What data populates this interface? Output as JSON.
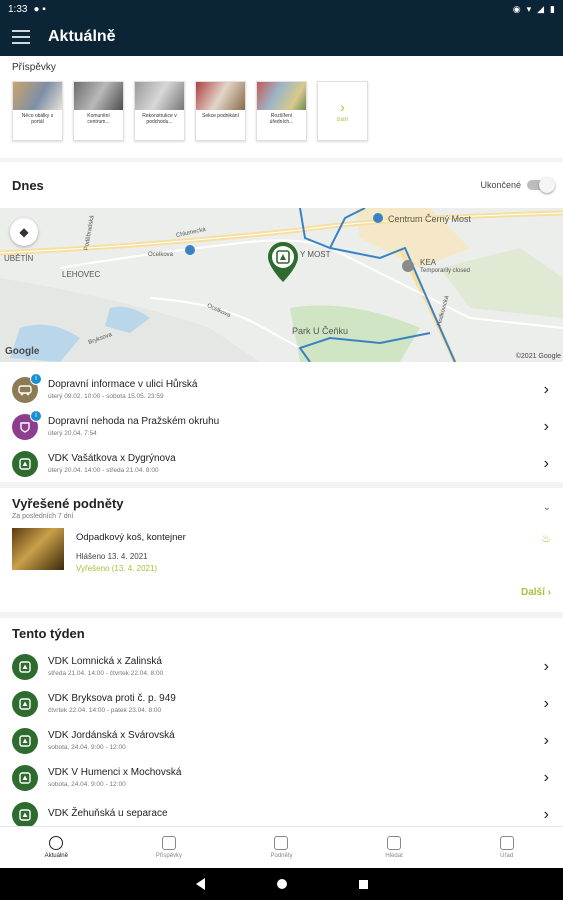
{
  "status_bar": {
    "time": "1:33"
  },
  "app_bar": {
    "title": "Aktuálně"
  },
  "posts": {
    "title": "Příspěvky",
    "items": [
      {
        "caption": "Něco obálky s portál"
      },
      {
        "caption": "Komunitní centrum..."
      },
      {
        "caption": "Rekonstrukce v podchodu..."
      },
      {
        "caption": "Sekce podnikání"
      },
      {
        "caption": "Rozšíření úředních..."
      }
    ],
    "more_label": "Další"
  },
  "today": {
    "title": "Dnes",
    "toggle_label": "Ukončené",
    "toggle_on": false,
    "map": {
      "labels": [
        "Centrum Černý Most",
        "Y MOST",
        "KEA",
        "Temporarily closed",
        "LEHOVEC",
        "UBĚTÍN",
        "Park U Čeňku",
        "Chlumecká",
        "Poděbradská",
        "Ocelkova",
        "Bryksova",
        "Hodkovická",
        "Ocelkova"
      ],
      "google": "Google",
      "copyright": "©2021 Google"
    },
    "items": [
      {
        "title": "Dopravní informace v ulici Hůrská",
        "subtitle": "úterý 09.02. 10:00 - sobota 15.05. 23:59",
        "icon": "traffic-icon",
        "color": "#8d7b55",
        "badge": "i"
      },
      {
        "title": "Dopravní nehoda na Pražském okruhu",
        "subtitle": "úterý 20.04. 7:54",
        "icon": "accident-icon",
        "color": "#8e3e8e",
        "badge": "i"
      },
      {
        "title": "VDK Vašátkova x Dygrýnova",
        "subtitle": "úterý 20.04. 14:00 - středa 21.04. 8:00",
        "icon": "container-icon",
        "color": "#2e6b2e",
        "badge": ""
      }
    ]
  },
  "resolved": {
    "title": "Vyřešené podněty",
    "subtitle": "Za posledních 7 dní",
    "item": {
      "title": "Odpadkový koš, kontejner",
      "reported": "Hlášeno 13. 4. 2021",
      "state": "Vyřešeno (13. 4. 2021)"
    },
    "more_label": "Další"
  },
  "week": {
    "title": "Tento týden",
    "items": [
      {
        "title": "VDK Lomnická x Zalinská",
        "subtitle": "středa 21.04. 14:00 - čtvrtek 22.04. 8:00"
      },
      {
        "title": "VDK Bryksova proti č. p. 949",
        "subtitle": "čtvrtek 22.04. 14:00 - pátek 23.04. 8:00"
      },
      {
        "title": "VDK Jordánská x Svárovská",
        "subtitle": "sobota, 24.04. 9:00 - 12:00"
      },
      {
        "title": "VDK V Humenci x Mochovská",
        "subtitle": "sobota, 24.04. 9:00 - 12:00"
      },
      {
        "title": "VDK Žehuňská u separace",
        "subtitle": ""
      }
    ]
  },
  "bottom_nav": [
    {
      "label": "Aktuálně",
      "active": true
    },
    {
      "label": "Příspěvky",
      "active": false
    },
    {
      "label": "Podněty",
      "active": false
    },
    {
      "label": "Hledat",
      "active": false
    },
    {
      "label": "Úřad",
      "active": false
    }
  ]
}
